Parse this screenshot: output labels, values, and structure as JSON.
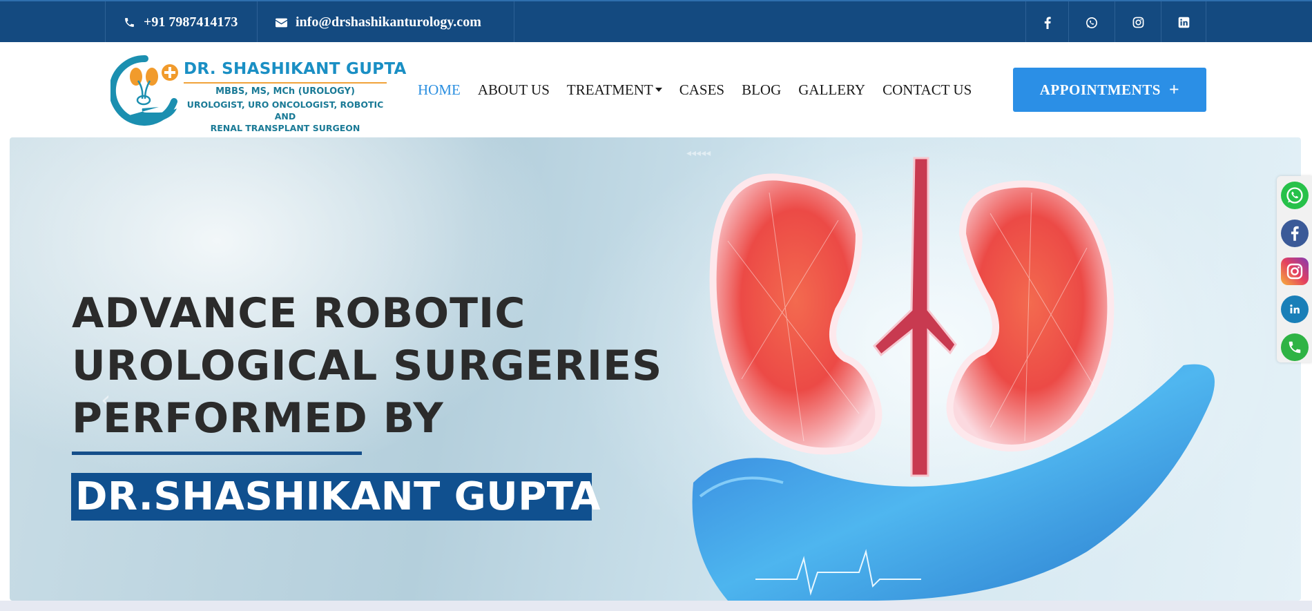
{
  "topbar": {
    "phone": "+91 7987414173",
    "email": "info@drshashikanturology.com",
    "social": [
      "facebook-icon",
      "whatsapp-icon",
      "instagram-icon",
      "linkedin-icon"
    ]
  },
  "logo": {
    "title": "DR. SHASHIKANT GUPTA",
    "degrees": "MBBS, MS, MCh (UROLOGY)",
    "specialty_line1": "UROLOGIST, URO ONCOLOGIST, ROBOTIC AND",
    "specialty_line2": "RENAL TRANSPLANT SURGEON"
  },
  "nav": {
    "items": [
      {
        "label": "HOME",
        "active": true
      },
      {
        "label": "ABOUT US"
      },
      {
        "label": "TREATMENT",
        "dropdown": true
      },
      {
        "label": "CASES"
      },
      {
        "label": "BLOG"
      },
      {
        "label": "GALLERY"
      },
      {
        "label": "CONTACT US"
      }
    ],
    "appointments": "APPOINTMENTS",
    "appointments_icon": "+"
  },
  "hero": {
    "line1": "ADVANCE ROBOTIC",
    "line2": "UROLOGICAL SURGERIES",
    "line3": "PERFORMED BY",
    "name": "DR.SHASHIKANT GUPTA",
    "prev_arrow": "‹"
  },
  "floating_social": [
    "whatsapp-icon",
    "facebook-icon",
    "instagram-icon",
    "linkedin-icon",
    "phone-icon"
  ],
  "colors": {
    "topbar": "#144a80",
    "accent": "#2b8fe6",
    "name_band": "#10508f",
    "logo_title": "#1a8fc4"
  }
}
